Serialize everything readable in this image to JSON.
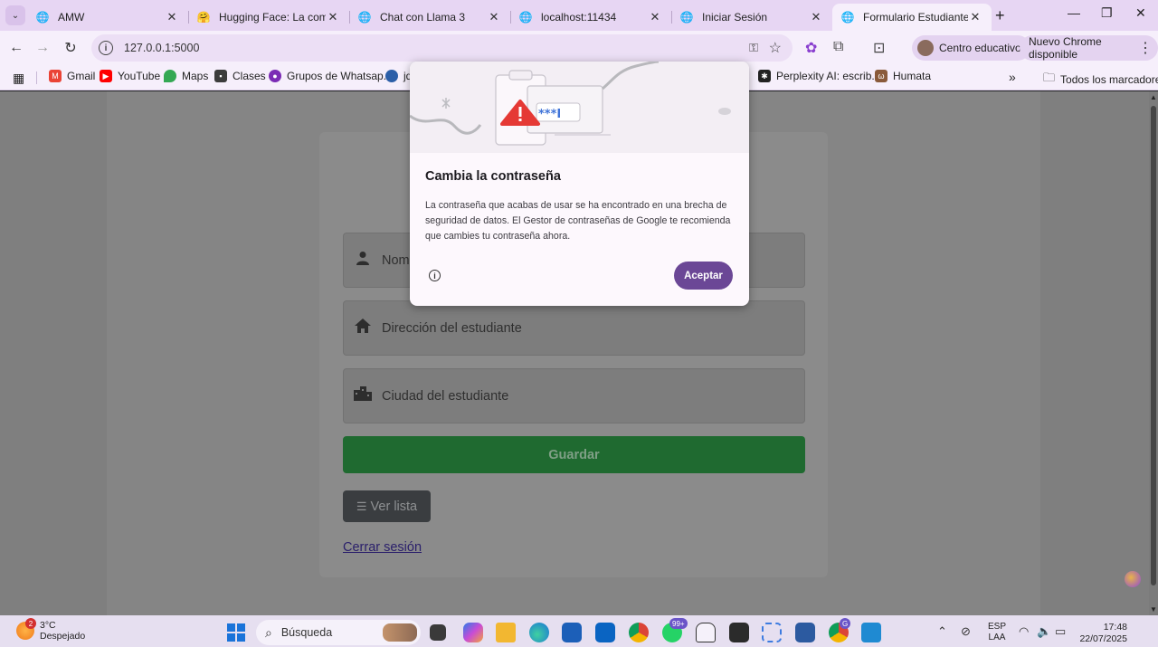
{
  "tabs": [
    {
      "title": "AMW",
      "favicon": "globe-icon",
      "active": false
    },
    {
      "title": "Hugging Face: La comunid",
      "favicon": "hugging-face-icon",
      "active": false
    },
    {
      "title": "Chat con Llama 3",
      "favicon": "globe-icon",
      "active": false
    },
    {
      "title": "localhost:11434",
      "favicon": "globe-icon",
      "active": false
    },
    {
      "title": "Iniciar Sesión",
      "favicon": "globe-icon",
      "active": false
    },
    {
      "title": "Formulario Estudiantes",
      "favicon": "globe-icon",
      "active": true
    }
  ],
  "toolbar": {
    "url": "127.0.0.1:5000",
    "profile_label": "Centro educativo",
    "update_label": "Nuevo Chrome disponible"
  },
  "bookmarks": {
    "items": [
      {
        "label": "Gmail",
        "icon": "gmail-icon",
        "color": "#ea4335"
      },
      {
        "label": "YouTube",
        "icon": "youtube-icon",
        "color": "#ff0000"
      },
      {
        "label": "Maps",
        "icon": "maps-icon",
        "color": "#34a853"
      },
      {
        "label": "Clases",
        "icon": "classroom-icon",
        "color": "#3c3c3c"
      },
      {
        "label": "Grupos de Whatsap...",
        "icon": "whatsapp-groups-icon",
        "color": "#7b2bb5"
      },
      {
        "label": "jd",
        "icon": "jd-icon",
        "color": "#2c5fa8"
      },
      {
        "label": "Perplexity AI: escrib...",
        "icon": "perplexity-icon",
        "color": "#222222"
      },
      {
        "label": "Humata",
        "icon": "humata-icon",
        "color": "#8a5a3a"
      }
    ],
    "all_label": "Todos los marcadores"
  },
  "form": {
    "name_placeholder": "Nomb",
    "address_placeholder": "Dirección del estudiante",
    "city_placeholder": "Ciudad del estudiante",
    "save_label": "Guardar",
    "list_label": "Ver lista",
    "logout_label": "Cerrar sesión"
  },
  "dialog": {
    "illustration_text": "***I",
    "title": "Cambia la contraseña",
    "body": "La contraseña que acabas de usar se ha encontrado en una brecha de seguridad de datos. El Gestor de contraseñas de Google te recomienda que cambies tu contraseña ahora.",
    "accept_label": "Aceptar"
  },
  "taskbar": {
    "weather_temp": "3°C",
    "weather_desc": "Despejado",
    "weather_badge": "2",
    "search_label": "Búsqueda",
    "whatsapp_badge": "99+",
    "chrome_profile_badge": "G",
    "lang_top": "ESP",
    "lang_bottom": "LAA",
    "time": "17:48",
    "date": "22/07/2025"
  },
  "colors": {
    "tabstrip": "#e7d6f3",
    "toolbar": "#f6effb",
    "accent_button": "#6b4796",
    "save_button": "#1f6a30"
  }
}
